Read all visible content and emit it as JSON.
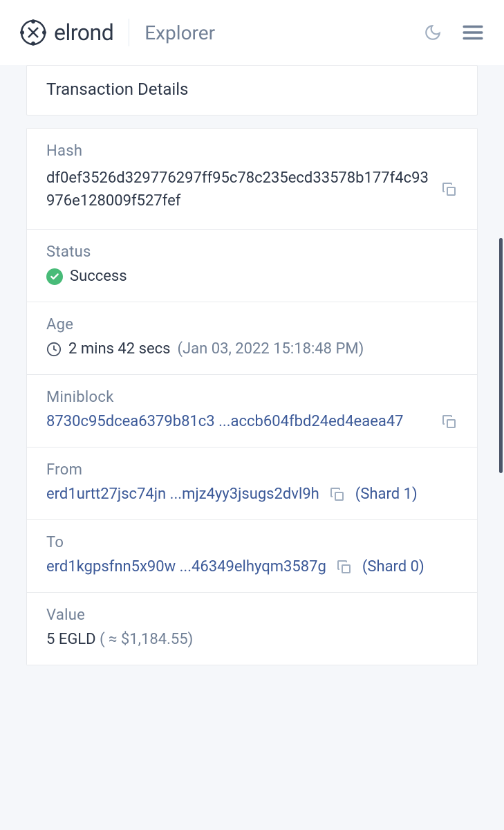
{
  "header": {
    "brand": "elrond",
    "subtitle": "Explorer"
  },
  "card": {
    "title": "Transaction Details"
  },
  "fields": {
    "hash": {
      "label": "Hash",
      "value": "df0ef3526d329776297ff95c78c235ecd33578b177f4c93976e128009f527fef"
    },
    "status": {
      "label": "Status",
      "value": "Success"
    },
    "age": {
      "label": "Age",
      "relative": "2 mins 42 secs",
      "absolute": "(Jan 03, 2022 15:18:48 PM)"
    },
    "miniblock": {
      "label": "Miniblock",
      "value": "8730c95dcea6379b81c3 ...accb604fbd24ed4eaea47"
    },
    "from": {
      "label": "From",
      "address": "erd1urtt27jsc74jn ...mjz4yy3jsugs2dvl9h",
      "shard": "(Shard 1)"
    },
    "to": {
      "label": "To",
      "address": "erd1kgpsfnn5x90w ...46349elhyqm3587g",
      "shard": "(Shard 0)"
    },
    "value": {
      "label": "Value",
      "amount": "5 EGLD",
      "usd": "( ≈ $1,184.55)"
    }
  }
}
